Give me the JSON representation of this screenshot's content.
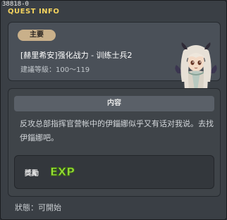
{
  "window": {
    "quest_id": "38818-0",
    "title": "QUEST INFO"
  },
  "header": {
    "category": "主要",
    "quest_name": "[赫里希安]强化战力 - 训练士兵2",
    "level_requirement": "建議等級：100～119"
  },
  "content": {
    "heading": "内容",
    "body": "反攻总部指挥官营帐中的伊錙娜似乎又有话对我说。去找伊錙娜吧。"
  },
  "reward": {
    "label": "獎勵",
    "icon_text": "EXP"
  },
  "status": "狀態：可開始",
  "colors": {
    "title": "#f4d35e",
    "pill": "#c9b08a",
    "exp_fill": "#9be23a",
    "exp_stroke": "#3f6f12"
  }
}
